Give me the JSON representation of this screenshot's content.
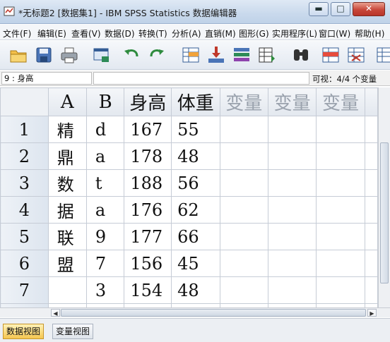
{
  "window": {
    "title": "*无标题2 [数据集1] - IBM SPSS Statistics 数据编辑器",
    "min_glyph": "▬",
    "max_glyph": "□",
    "close_glyph": "✕"
  },
  "menu": [
    "文件(F)",
    "编辑(E)",
    "查看(V)",
    "数据(D)",
    "转换(T)",
    "分析(A)",
    "直销(M)",
    "图形(G)",
    "实用程序(L)",
    "窗口(W)",
    "帮助(H)"
  ],
  "toolbar_icons": [
    "open-folder-icon",
    "save-icon",
    "print-icon",
    "dialog-recall-icon",
    "undo-icon",
    "redo-icon",
    "goto-case-icon",
    "goto-variable-icon",
    "variables-icon",
    "run-descriptives-icon",
    "find-icon",
    "insert-cases-icon",
    "insert-variable-icon",
    "split-file-icon"
  ],
  "editor": {
    "cell_ref": "9 : 身高",
    "cell_value": "",
    "visible_count": "可视：4/4 个变量"
  },
  "grid": {
    "columns": [
      "A",
      "B",
      "身高",
      "体重",
      "变量",
      "变量",
      "变量"
    ],
    "rows": [
      {
        "num": "1",
        "A": "精",
        "B": "d",
        "height": "167",
        "weight": "55"
      },
      {
        "num": "2",
        "A": "鼎",
        "B": "a",
        "height": "178",
        "weight": "48"
      },
      {
        "num": "3",
        "A": "数",
        "B": "t",
        "height": "188",
        "weight": "56"
      },
      {
        "num": "4",
        "A": "据",
        "B": "a",
        "height": "176",
        "weight": "62"
      },
      {
        "num": "5",
        "A": "联",
        "B": "9",
        "height": "177",
        "weight": "66"
      },
      {
        "num": "6",
        "A": "盟",
        "B": "7",
        "height": "156",
        "weight": "45"
      },
      {
        "num": "7",
        "A": "",
        "B": "3",
        "height": "154",
        "weight": "48"
      },
      {
        "num": "",
        "A": "",
        "B": "",
        "height": "",
        "weight": ""
      }
    ]
  },
  "scroll": {
    "left_arrow": "◀",
    "right_arrow": "▶"
  },
  "tabs": {
    "data_view": "数据视图",
    "variable_view": "变量视图"
  }
}
